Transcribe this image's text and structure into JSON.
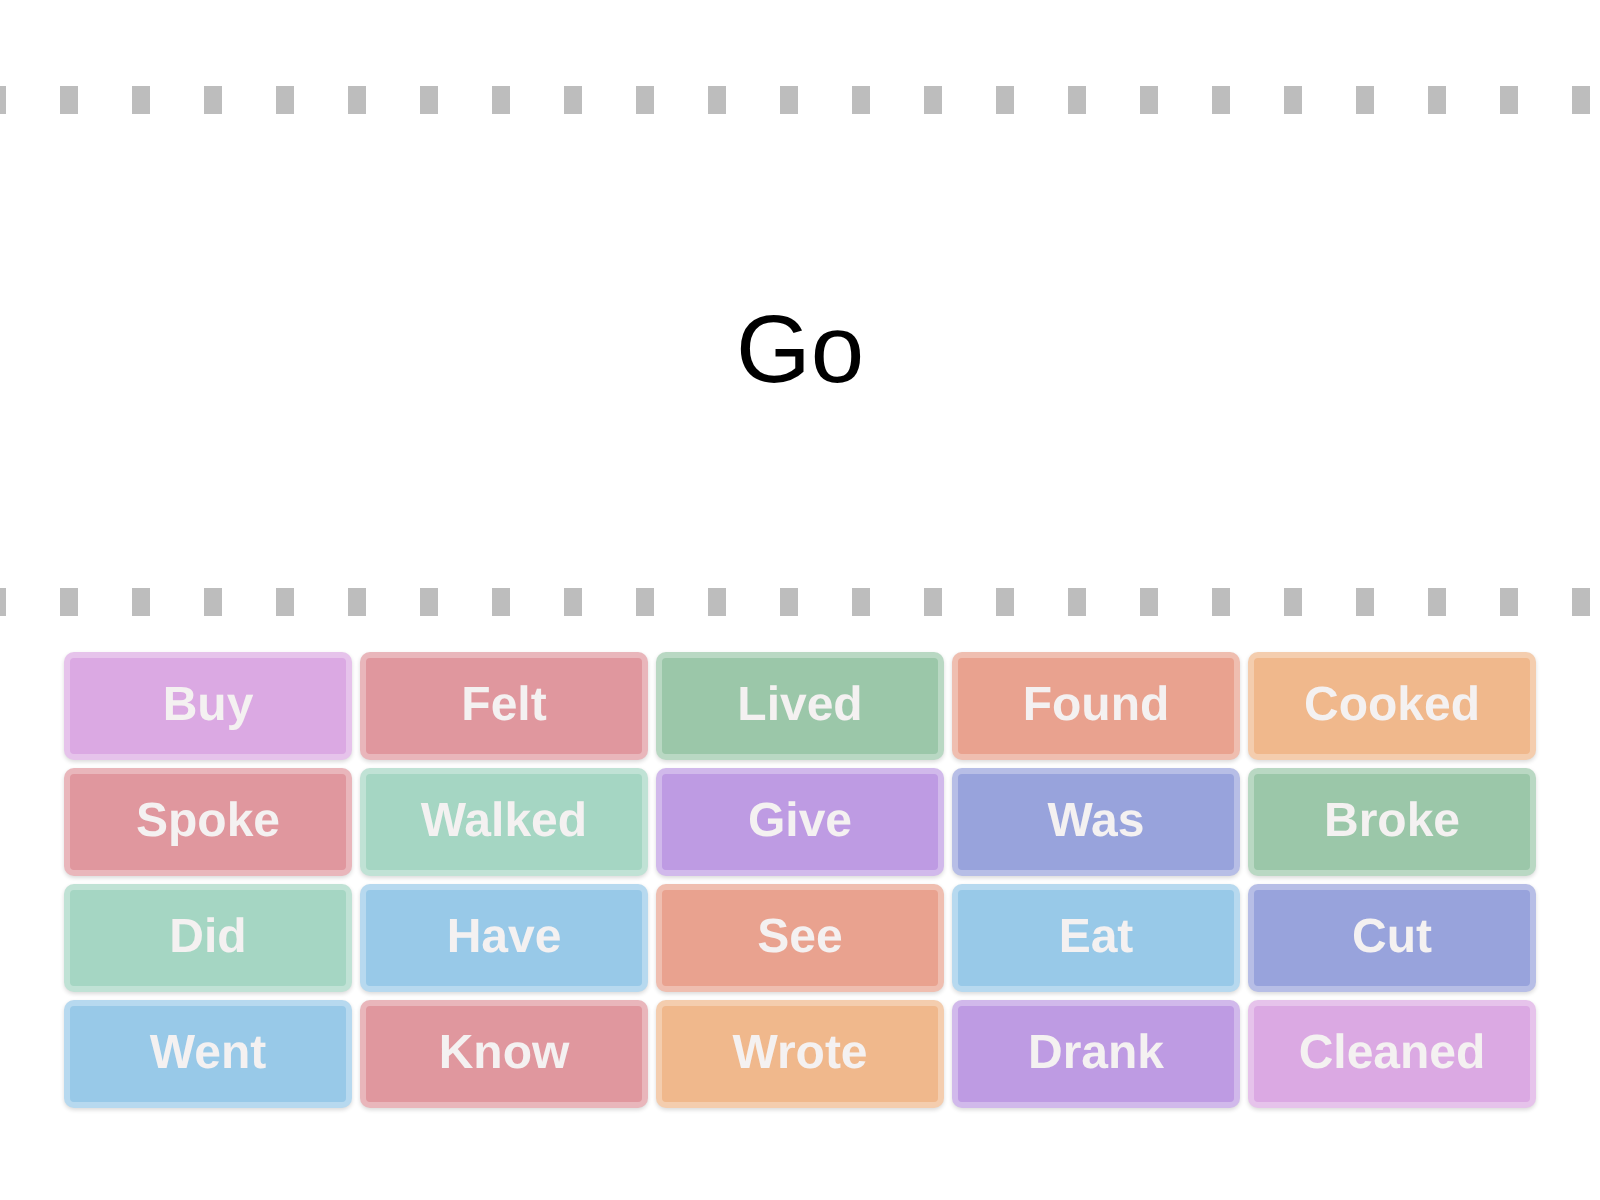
{
  "prompt": {
    "text": "Go"
  },
  "tiles": [
    {
      "label": "Buy",
      "color": "#dba9e3"
    },
    {
      "label": "Felt",
      "color": "#e0979e"
    },
    {
      "label": "Lived",
      "color": "#9bc7a9"
    },
    {
      "label": "Found",
      "color": "#e9a28f"
    },
    {
      "label": "Cooked",
      "color": "#f0b88c"
    },
    {
      "label": "Spoke",
      "color": "#e0979e"
    },
    {
      "label": "Walked",
      "color": "#a5d6c3"
    },
    {
      "label": "Give",
      "color": "#be9be3"
    },
    {
      "label": "Was",
      "color": "#98a3dc"
    },
    {
      "label": "Broke",
      "color": "#9bc7a9"
    },
    {
      "label": "Did",
      "color": "#a5d6c3"
    },
    {
      "label": "Have",
      "color": "#98c9e8"
    },
    {
      "label": "See",
      "color": "#e9a28f"
    },
    {
      "label": "Eat",
      "color": "#98c9e8"
    },
    {
      "label": "Cut",
      "color": "#98a3dc"
    },
    {
      "label": "Went",
      "color": "#98c9e8"
    },
    {
      "label": "Know",
      "color": "#e0979e"
    },
    {
      "label": "Wrote",
      "color": "#f0b88c"
    },
    {
      "label": "Drank",
      "color": "#be9be3"
    },
    {
      "label": "Cleaned",
      "color": "#dba9e3"
    }
  ]
}
